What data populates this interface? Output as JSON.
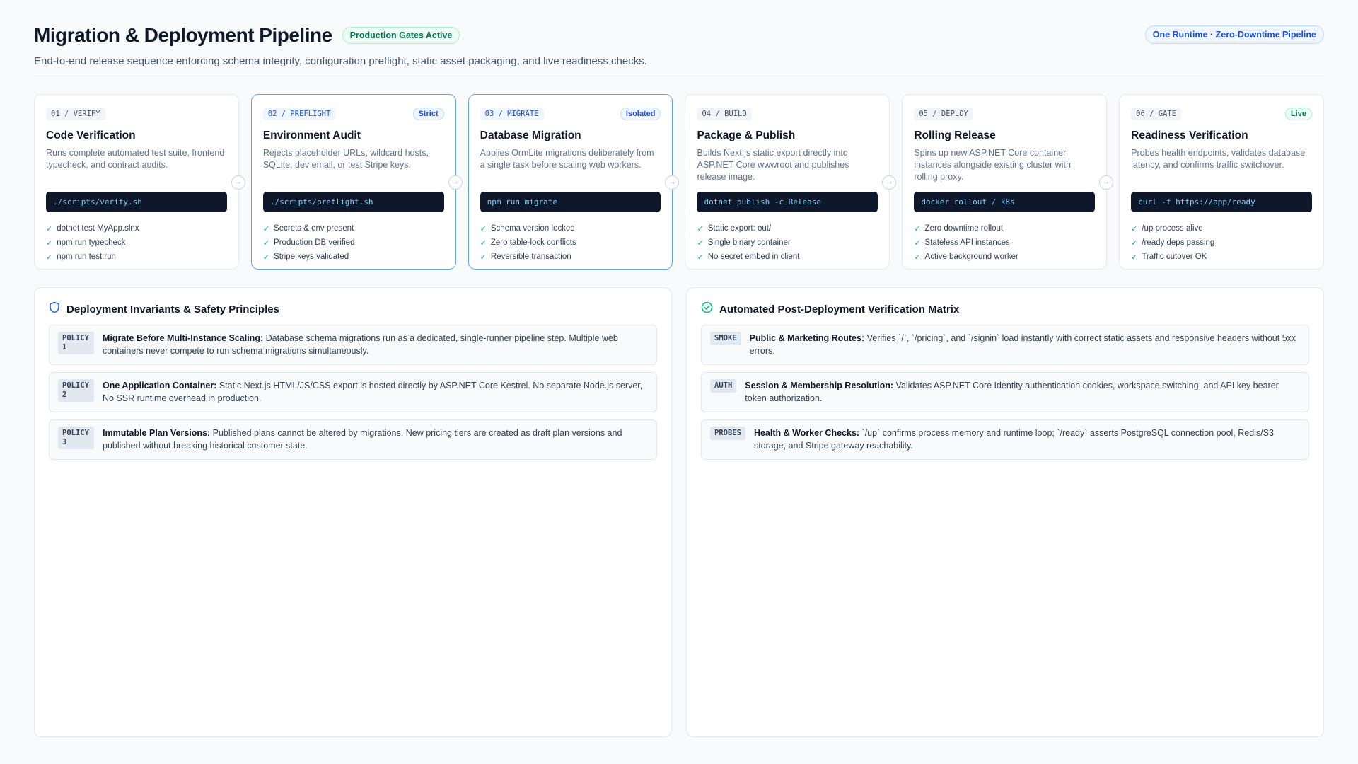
{
  "header": {
    "title": "Migration & Deployment Pipeline",
    "status_badge": "Production Gates Active",
    "subtitle": "End-to-end release sequence enforcing schema integrity, configuration preflight, static asset packaging, and live readiness checks.",
    "runtime_badge": "One Runtime · Zero-Downtime Pipeline"
  },
  "colors": {
    "accent": "#2563eb",
    "success": "#10b981",
    "terminal_bg": "#0f172a",
    "terminal_text": "#7dd3fc"
  },
  "stages": [
    {
      "id": "01 / VERIFY",
      "tag": "",
      "name": "Code Verification",
      "desc": "Runs complete automated test suite, frontend typecheck, and contract audits.",
      "cmd": "./scripts/verify.sh",
      "checks": [
        "dotnet test MyApp.slnx",
        "npm run typecheck",
        "npm run test:run"
      ]
    },
    {
      "id": "02 / PREFLIGHT",
      "tag": "Strict",
      "name": "Environment Audit",
      "desc": "Rejects placeholder URLs, wildcard hosts, SQLite, dev email, or test Stripe keys.",
      "cmd": "./scripts/preflight.sh",
      "checks": [
        "Secrets & env present",
        "Production DB verified",
        "Stripe keys validated"
      ]
    },
    {
      "id": "03 / MIGRATE",
      "tag": "Isolated",
      "name": "Database Migration",
      "desc": "Applies OrmLite migrations deliberately from a single task before scaling web workers.",
      "cmd": "npm run migrate",
      "checks": [
        "Schema version locked",
        "Zero table-lock conflicts",
        "Reversible transaction"
      ]
    },
    {
      "id": "04 / BUILD",
      "tag": "",
      "name": "Package & Publish",
      "desc": "Builds Next.js static export directly into ASP.NET Core wwwroot and publishes release image.",
      "cmd": "dotnet publish -c Release",
      "checks": [
        "Static export: out/",
        "Single binary container",
        "No secret embed in client"
      ]
    },
    {
      "id": "05 / DEPLOY",
      "tag": "",
      "name": "Rolling Release",
      "desc": "Spins up new ASP.NET Core container instances alongside existing cluster with rolling proxy.",
      "cmd": "docker rollout / k8s",
      "checks": [
        "Zero downtime rollout",
        "Stateless API instances",
        "Active background worker"
      ]
    },
    {
      "id": "06 / GATE",
      "tag": "Live",
      "name": "Readiness Verification",
      "desc": "Probes health endpoints, validates database latency, and confirms traffic switchover.",
      "cmd": "curl -f https://app/ready",
      "checks": [
        "/up process alive",
        "/ready deps passing",
        "Traffic cutover OK"
      ]
    }
  ],
  "invariants": {
    "title": "Deployment Invariants & Safety Principles",
    "items": [
      {
        "tag": "POLICY 1",
        "heading": "Migrate Before Multi-Instance Scaling:",
        "body": "Database schema migrations run as a dedicated, single-runner pipeline step. Multiple web containers never compete to run schema migrations simultaneously."
      },
      {
        "tag": "POLICY 2",
        "heading": "One Application Container:",
        "body": "Static Next.js HTML/JS/CSS export is hosted directly by ASP.NET Core Kestrel. No separate Node.js server, No SSR runtime overhead in production."
      },
      {
        "tag": "POLICY 3",
        "heading": "Immutable Plan Versions:",
        "body": "Published plans cannot be altered by migrations. New pricing tiers are created as draft plan versions and published without breaking historical customer state."
      }
    ]
  },
  "verification": {
    "title": "Automated Post-Deployment Verification Matrix",
    "items": [
      {
        "tag": "SMOKE",
        "heading": "Public & Marketing Routes:",
        "body": "Verifies `/`, `/pricing`, and `/signin` load instantly with correct static assets and responsive headers without 5xx errors."
      },
      {
        "tag": "AUTH",
        "heading": "Session & Membership Resolution:",
        "body": "Validates ASP.NET Core Identity authentication cookies, workspace switching, and API key bearer token authorization."
      },
      {
        "tag": "PROBES",
        "heading": "Health & Worker Checks:",
        "body": "`/up` confirms process memory and runtime loop; `/ready` asserts PostgreSQL connection pool, Redis/S3 storage, and Stripe gateway reachability."
      }
    ]
  }
}
